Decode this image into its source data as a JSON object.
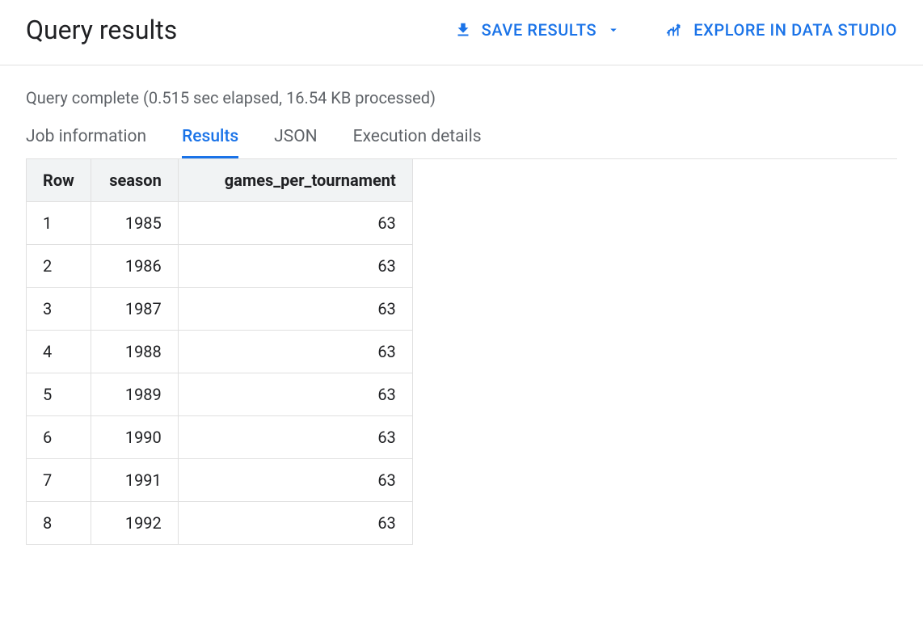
{
  "header": {
    "title": "Query results",
    "save_label": "SAVE RESULTS",
    "explore_label": "EXPLORE IN DATA STUDIO"
  },
  "status_text": "Query complete (0.515 sec elapsed, 16.54 KB processed)",
  "tabs": {
    "job_info": "Job information",
    "results": "Results",
    "json": "JSON",
    "execution": "Execution details",
    "active": "results"
  },
  "table": {
    "columns": [
      "Row",
      "season",
      "games_per_tournament"
    ],
    "rows": [
      {
        "row": "1",
        "season": "1985",
        "games_per_tournament": "63"
      },
      {
        "row": "2",
        "season": "1986",
        "games_per_tournament": "63"
      },
      {
        "row": "3",
        "season": "1987",
        "games_per_tournament": "63"
      },
      {
        "row": "4",
        "season": "1988",
        "games_per_tournament": "63"
      },
      {
        "row": "5",
        "season": "1989",
        "games_per_tournament": "63"
      },
      {
        "row": "6",
        "season": "1990",
        "games_per_tournament": "63"
      },
      {
        "row": "7",
        "season": "1991",
        "games_per_tournament": "63"
      },
      {
        "row": "8",
        "season": "1992",
        "games_per_tournament": "63"
      }
    ]
  }
}
